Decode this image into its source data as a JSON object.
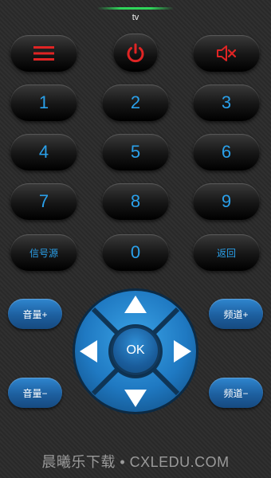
{
  "header": {
    "title": "tv"
  },
  "top_row": {
    "menu": {
      "icon": "menu-icon"
    },
    "power": {
      "icon": "power-icon"
    },
    "mute": {
      "icon": "mute-speaker-icon"
    }
  },
  "keypad": {
    "digits": [
      "1",
      "2",
      "3",
      "4",
      "5",
      "6",
      "7",
      "8",
      "9"
    ],
    "signal_source_label": "信号源",
    "zero_label": "0",
    "back_label": "返回"
  },
  "side_buttons": {
    "volume_up_label": "音量+",
    "volume_down_label": "音量−",
    "channel_up_label": "频道+",
    "channel_down_label": "频道−"
  },
  "dpad": {
    "ok_label": "OK",
    "up_icon": "arrow-up-icon",
    "down_icon": "arrow-down-icon",
    "left_icon": "arrow-left-icon",
    "right_icon": "arrow-right-icon"
  },
  "watermark": {
    "text": "晨曦乐下载 • CXLEDU.COM"
  },
  "colors": {
    "background": "#2b2b2b",
    "digit_text": "#2aa0ea",
    "icon_red": "#e02424",
    "accent_blue": "#1d6fb8",
    "status_green": "#2fd65a"
  }
}
